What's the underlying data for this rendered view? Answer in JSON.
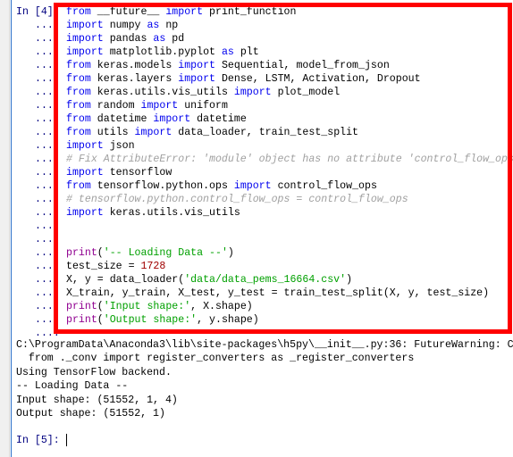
{
  "cells": {
    "input_prompt": "In [4]:",
    "continuation_prompt": "...:",
    "code_lines": [
      [
        [
          "kw",
          "from"
        ],
        [
          "t",
          " __future__ "
        ],
        [
          "kw",
          "import"
        ],
        [
          "t",
          " print_function"
        ]
      ],
      [
        [
          "kw",
          "import"
        ],
        [
          "t",
          " numpy "
        ],
        [
          "kw",
          "as"
        ],
        [
          "t",
          " np"
        ]
      ],
      [
        [
          "kw",
          "import"
        ],
        [
          "t",
          " pandas "
        ],
        [
          "kw",
          "as"
        ],
        [
          "t",
          " pd"
        ]
      ],
      [
        [
          "kw",
          "import"
        ],
        [
          "t",
          " matplotlib.pyplot "
        ],
        [
          "kw",
          "as"
        ],
        [
          "t",
          " plt"
        ]
      ],
      [
        [
          "kw",
          "from"
        ],
        [
          "t",
          " keras.models "
        ],
        [
          "kw",
          "import"
        ],
        [
          "t",
          " Sequential, model_from_json"
        ]
      ],
      [
        [
          "kw",
          "from"
        ],
        [
          "t",
          " keras.layers "
        ],
        [
          "kw",
          "import"
        ],
        [
          "t",
          " Dense, LSTM, Activation, Dropout"
        ]
      ],
      [
        [
          "kw",
          "from"
        ],
        [
          "t",
          " keras.utils.vis_utils "
        ],
        [
          "kw",
          "import"
        ],
        [
          "t",
          " plot_model"
        ]
      ],
      [
        [
          "kw",
          "from"
        ],
        [
          "t",
          " random "
        ],
        [
          "kw",
          "import"
        ],
        [
          "t",
          " uniform"
        ]
      ],
      [
        [
          "kw",
          "from"
        ],
        [
          "t",
          " datetime "
        ],
        [
          "kw",
          "import"
        ],
        [
          "t",
          " datetime"
        ]
      ],
      [
        [
          "kw",
          "from"
        ],
        [
          "t",
          " utils "
        ],
        [
          "kw",
          "import"
        ],
        [
          "t",
          " data_loader, train_test_split"
        ]
      ],
      [
        [
          "kw",
          "import"
        ],
        [
          "t",
          " json"
        ]
      ],
      [
        [
          "com",
          "# Fix AttributeError: 'module' object has no attribute 'control_flow_ops'"
        ]
      ],
      [
        [
          "kw",
          "import"
        ],
        [
          "t",
          " tensorflow"
        ]
      ],
      [
        [
          "kw",
          "from"
        ],
        [
          "t",
          " tensorflow.python.ops "
        ],
        [
          "kw",
          "import"
        ],
        [
          "t",
          " control_flow_ops"
        ]
      ],
      [
        [
          "com",
          "# tensorflow.python.control_flow_ops = control_flow_ops"
        ]
      ],
      [
        [
          "kw",
          "import"
        ],
        [
          "t",
          " keras.utils.vis_utils"
        ]
      ],
      [],
      [],
      [
        [
          "bi",
          "print"
        ],
        [
          "t",
          "("
        ],
        [
          "str",
          "'-- Loading Data --'"
        ],
        [
          "t",
          ")"
        ]
      ],
      [
        [
          "t",
          "test_size = "
        ],
        [
          "num",
          "1728"
        ]
      ],
      [
        [
          "t",
          "X, y = data_loader("
        ],
        [
          "str",
          "'data/data_pems_16664.csv'"
        ],
        [
          "t",
          ")"
        ]
      ],
      [
        [
          "t",
          "X_train, y_train, X_test, y_test = train_test_split(X, y, test_size)"
        ]
      ],
      [
        [
          "bi",
          "print"
        ],
        [
          "t",
          "("
        ],
        [
          "str",
          "'Input shape:'"
        ],
        [
          "t",
          ", X.shape)"
        ]
      ],
      [
        [
          "bi",
          "print"
        ],
        [
          "t",
          "("
        ],
        [
          "str",
          "'Output shape:'"
        ],
        [
          "t",
          ", y.shape)"
        ]
      ],
      []
    ],
    "output_lines": [
      "C:\\ProgramData\\Anaconda3\\lib\\site-packages\\h5py\\__init__.py:36: FutureWarning: C",
      "  from ._conv import register_converters as _register_converters",
      "Using TensorFlow backend.",
      "-- Loading Data --",
      "Input shape: (51552, 1, 4)",
      "Output shape: (51552, 1)"
    ],
    "next_prompt": "In [5]:"
  },
  "colors": {
    "highlight_box": "#ff0000",
    "keyword": "#0000ee",
    "string": "#00a000",
    "comment": "#a0a0a0",
    "number": "#a00000",
    "builtin": "#900090",
    "prompt": "#000080"
  }
}
